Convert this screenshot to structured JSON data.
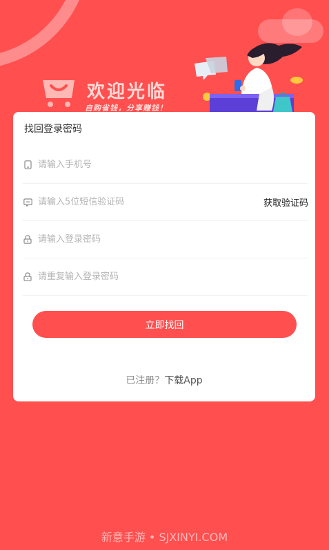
{
  "header": {
    "welcome_title": "欢迎光临",
    "slogan": "自购省钱，分享赚钱！"
  },
  "card": {
    "title": "找回登录密码",
    "phone_placeholder": "请输入手机号",
    "code_placeholder": "请输入5位短信验证码",
    "get_code_label": "获取验证码",
    "password_placeholder": "请输入登录密码",
    "confirm_password_placeholder": "请重复输入登录密码",
    "submit_label": "立即找回",
    "registered_text": "已注册？",
    "download_label": "下载App"
  },
  "watermark": "新意手游 • SJXINYI.COM",
  "icons": {
    "phone": "phone-icon",
    "sms": "sms-icon",
    "lock": "lock-icon",
    "cart": "shopping-cart-icon"
  },
  "colors": {
    "background": "#FF4F4F",
    "accent": "#FF4F4F",
    "card": "#FFFFFF"
  }
}
